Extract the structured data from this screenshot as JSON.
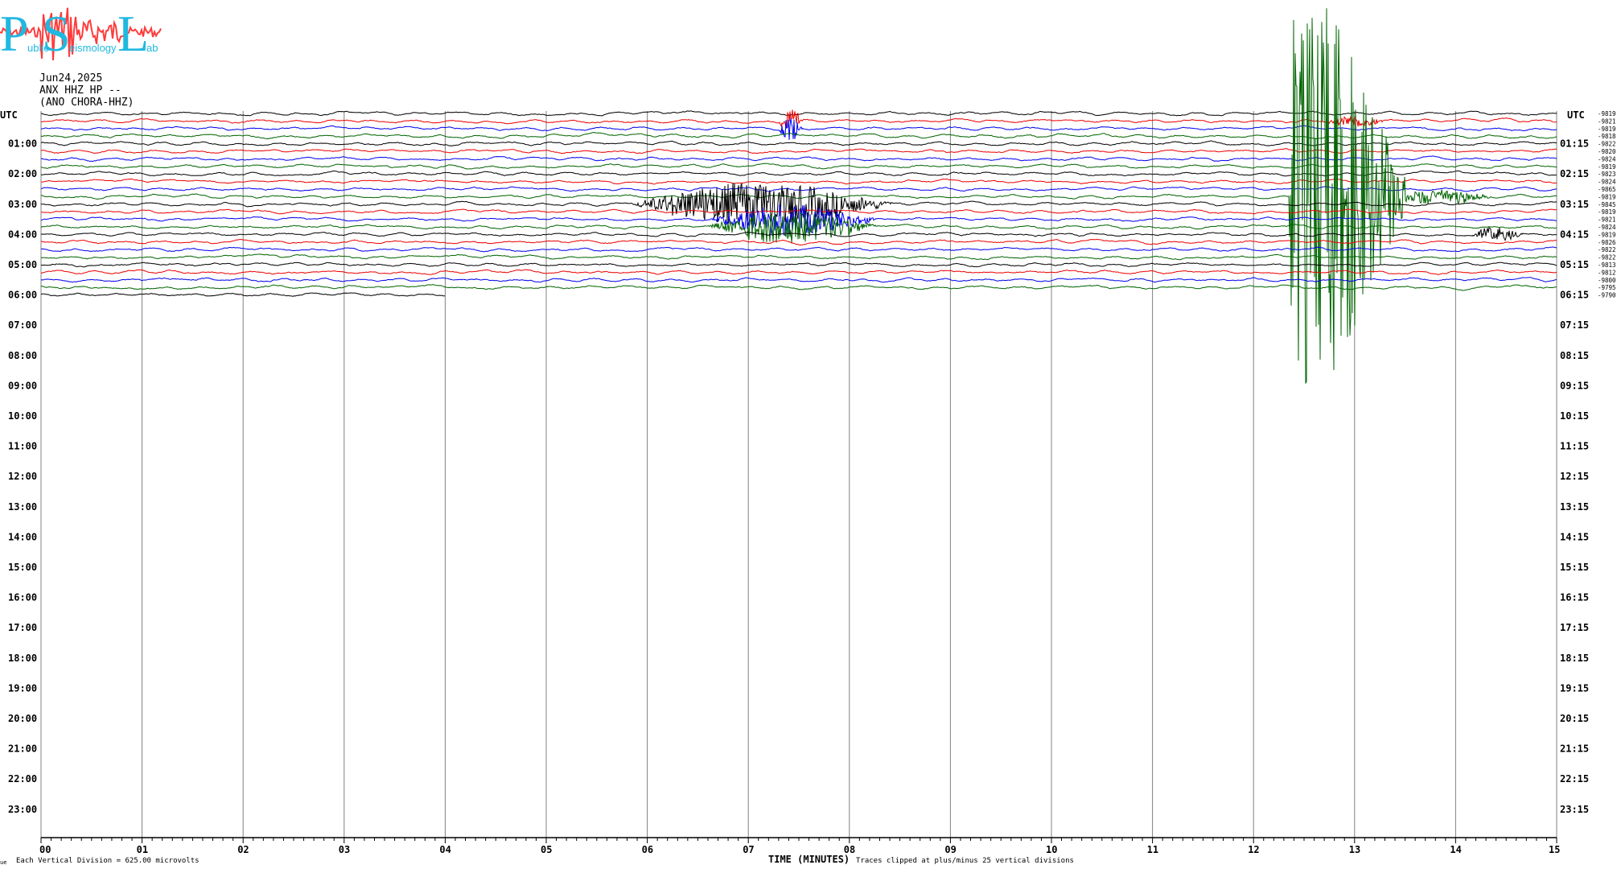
{
  "logo": {
    "letters": [
      "P",
      "S",
      "L"
    ],
    "words": [
      "ublic",
      "eismology",
      "ab"
    ]
  },
  "header": {
    "date": "Jun24,2025",
    "channel": "ANX HHZ HP --",
    "station": "(ANO CHORA-HHZ)"
  },
  "left_axis_title": "UTC",
  "right_axis_title": "UTC",
  "left_hour_labels": [
    "01:00",
    "02:00",
    "03:00",
    "04:00",
    "05:00",
    "06:00",
    "07:00",
    "08:00",
    "09:00",
    "10:00",
    "11:00",
    "12:00",
    "13:00",
    "14:00",
    "15:00",
    "16:00",
    "17:00",
    "18:00",
    "19:00",
    "20:00",
    "21:00",
    "22:00",
    "23:00"
  ],
  "right_hour_labels": [
    "01:15",
    "02:15",
    "03:15",
    "04:15",
    "05:15",
    "06:15",
    "07:15",
    "08:15",
    "09:15",
    "10:15",
    "11:15",
    "12:15",
    "13:15",
    "14:15",
    "15:15",
    "16:15",
    "17:15",
    "18:15",
    "19:15",
    "20:15",
    "21:15",
    "22:15",
    "23:15"
  ],
  "footer": {
    "mark": "ue",
    "scale_note": "Each Vertical Division =  625.00 microvolts",
    "x_title": "TIME (MINUTES)",
    "clip_note": "Traces clipped at plus/minus 25 vertical divisions"
  },
  "colors": {
    "black": "#000000",
    "red": "#ee0000",
    "blue": "#0000ee",
    "green": "#006400",
    "grid": "#808080",
    "logo_letters": "#21b8e0",
    "logo_trace": "#ff3b3b"
  },
  "chart_data": {
    "type": "line",
    "subtype": "helicorder",
    "x": {
      "title": "TIME (MINUTES)",
      "range": [
        0,
        15
      ],
      "ticks": [
        "00",
        "01",
        "02",
        "03",
        "04",
        "05",
        "06",
        "07",
        "08",
        "09",
        "10",
        "11",
        "12",
        "13",
        "14",
        "15"
      ]
    },
    "rows_per_hour": 4,
    "minutes_per_row": 15,
    "hours_covered": 24,
    "trace_color_cycle": [
      "black",
      "red",
      "blue",
      "green"
    ],
    "row_mean_counts": [
      "-9819",
      "-9821",
      "-9819",
      "-9818",
      "-9822",
      "-9820",
      "-9824",
      "-9819",
      "-9823",
      "-9824",
      "-9865",
      "-9819",
      "-9845",
      "-9819",
      "-9821",
      "-9824",
      "-9819",
      "-9826",
      "-9822",
      "-9822",
      "-9813",
      "-9812",
      "-9800",
      "-9795",
      "-9790"
    ],
    "recorded_rows": 25,
    "last_row_end_minute": 4,
    "events": [
      {
        "rows": [
          1,
          2
        ],
        "start_min": 7.3,
        "end_min": 7.7,
        "peak_divisions": 0.9
      },
      {
        "rows": [
          1
        ],
        "start_min": 12.7,
        "end_min": 13.7,
        "peak_divisions": 0.4
      },
      {
        "rows": [
          12
        ],
        "start_min": 5.85,
        "end_min": 10.0,
        "peak_divisions": 1.6
      },
      {
        "rows": [
          14,
          15
        ],
        "start_min": 6.6,
        "end_min": 9.3,
        "peak_divisions": 1.2
      },
      {
        "rows": [
          11
        ],
        "start_min": 12.35,
        "end_min": 13.5,
        "peak_divisions": 25
      },
      {
        "rows": [
          11
        ],
        "start_min": 13.3,
        "end_min": 15.0,
        "peak_divisions": 0.6
      },
      {
        "rows": [
          16
        ],
        "start_min": 14.15,
        "end_min": 15.0,
        "peak_divisions": 0.5
      }
    ],
    "clip_divisions": 25,
    "division_microvolts": 625.0
  }
}
